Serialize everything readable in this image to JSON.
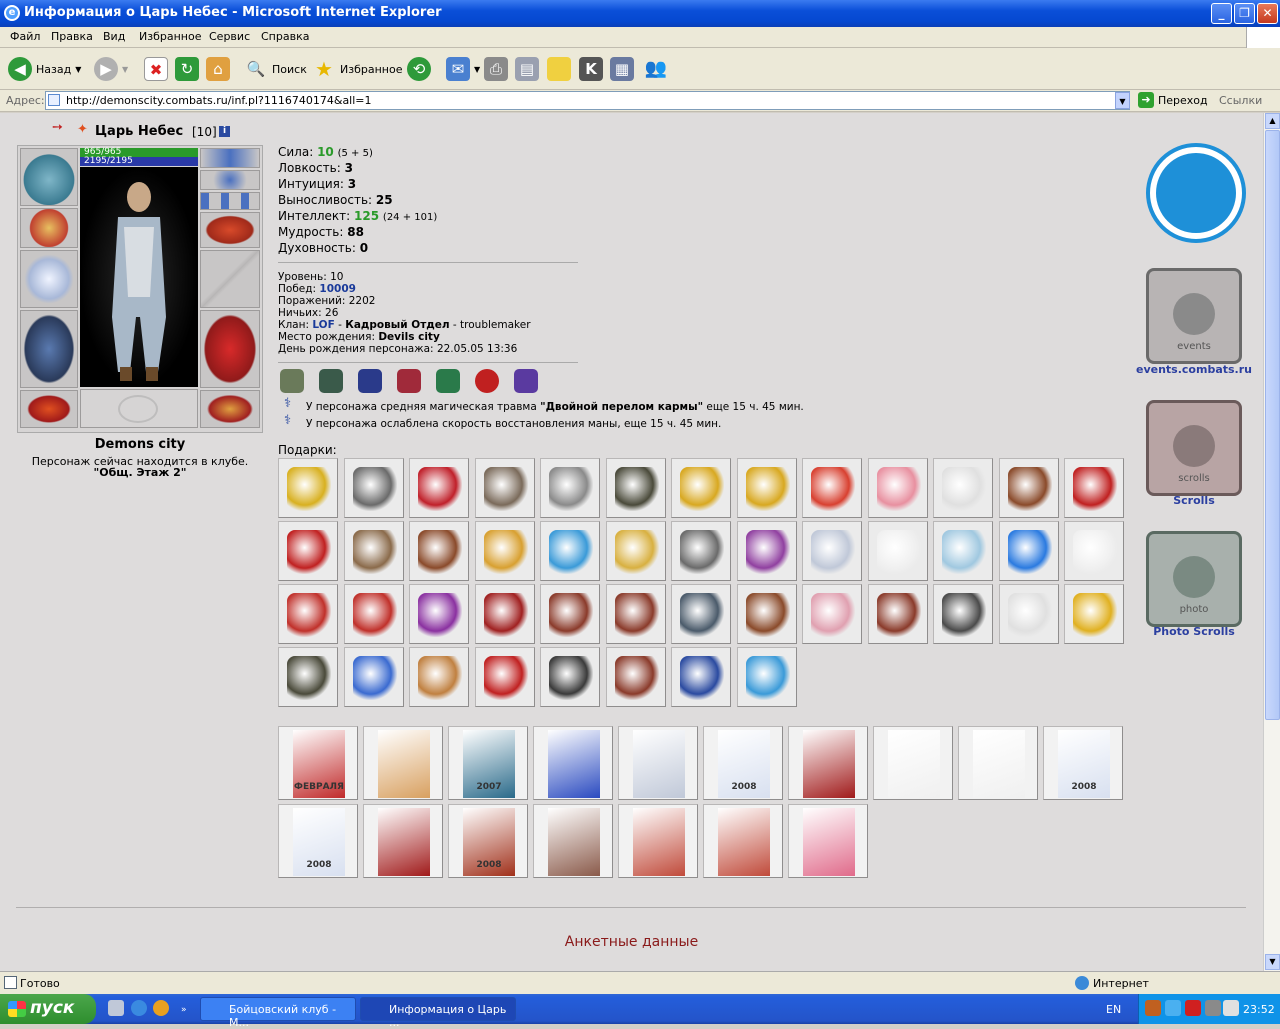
{
  "window": {
    "title": "Информация о Царь Небес - Microsoft Internet Explorer"
  },
  "menu": [
    "Файл",
    "Правка",
    "Вид",
    "Избранное",
    "Сервис",
    "Справка"
  ],
  "toolbar": {
    "back": "Назад",
    "search": "Поиск",
    "favorites": "Избранное"
  },
  "address": {
    "label": "Адрес:",
    "url": "http://demonscity.combats.ru/inf.pl?1116740174&all=1",
    "go": "Переход",
    "links": "Ссылки"
  },
  "character": {
    "name": "Царь Небес",
    "level_tag": "[10]",
    "hp": "965/965",
    "mana": "2195/2195",
    "city": "Demons city",
    "location_text": "Персонаж сейчас находится в клубе.",
    "location_room": "\"Общ. Этаж 2\""
  },
  "stats": [
    {
      "label": "Сила:",
      "value": "10",
      "extra": "(5 + 5)",
      "highlight": true
    },
    {
      "label": "Ловкость:",
      "value": "3",
      "extra": "",
      "highlight": false
    },
    {
      "label": "Интуиция:",
      "value": "3",
      "extra": "",
      "highlight": false
    },
    {
      "label": "Выносливость:",
      "value": "25",
      "extra": "",
      "highlight": false
    },
    {
      "label": "Интеллект:",
      "value": "125",
      "extra": "(24 + 101)",
      "highlight": true
    },
    {
      "label": "Мудрость:",
      "value": "88",
      "extra": "",
      "highlight": false
    },
    {
      "label": "Духовность:",
      "value": "0",
      "extra": "",
      "highlight": false
    }
  ],
  "info": {
    "level_label": "Уровень:",
    "level": "10",
    "wins_label": "Побед:",
    "wins": "10009",
    "losses_label": "Поражений:",
    "losses": "2202",
    "draws_label": "Ничьих:",
    "draws": "26",
    "clan_label": "Клан:",
    "clan": "LOF",
    "clan_sep1": " - ",
    "clan_dept": "Кадровый Отдел",
    "clan_sep2": " - troublemaker",
    "birthplace_label": "Место рождения:",
    "birthplace": "Devils city",
    "birthday_label": "День рождения персонажа:",
    "birthday": "22.05.05 13:36"
  },
  "effects": [
    {
      "pre": "У персонажа средняя магическая травма ",
      "bold": "\"Двойной перелом кармы\"",
      "post": " еще 15 ч. 45 мин."
    },
    {
      "pre": "У персонажа ослаблена скорость восстановления маны, еще 15 ч. 45 мин.",
      "bold": "",
      "post": ""
    }
  ],
  "gifts_label": "Подарки:",
  "gift_icons": [
    {
      "icon": "gold-ring-icon",
      "color": "#d8b020"
    },
    {
      "icon": "microphone-stand-icon",
      "color": "#6a6a6a"
    },
    {
      "icon": "red-skates-icon",
      "color": "#c0202a"
    },
    {
      "icon": "fishing-rod-icon",
      "color": "#7a6a5a"
    },
    {
      "icon": "keychain-icon",
      "color": "#8a8a8a"
    },
    {
      "icon": "army-hat-icon",
      "color": "#4a4a3a"
    },
    {
      "icon": "gold-bar-icon",
      "color": "#d8a820"
    },
    {
      "icon": "gold-bar-icon",
      "color": "#d8a820"
    },
    {
      "icon": "crystal-ball-icon",
      "color": "#d84030"
    },
    {
      "icon": "pig-icon",
      "color": "#e890a0"
    },
    {
      "icon": "vaseline-tube-icon",
      "color": "#e0e0e0"
    },
    {
      "icon": "wooden-mug-icon",
      "color": "#8a4a2a"
    },
    {
      "icon": "santa-icon",
      "color": "#c02020"
    },
    {
      "icon": "santa-icon",
      "color": "#c02020"
    },
    {
      "icon": "ball-icon",
      "color": "#8a6a4a"
    },
    {
      "icon": "wooden-mug-icon",
      "color": "#8a4a2a"
    },
    {
      "icon": "gold-medal-icon",
      "color": "#d8a030"
    },
    {
      "icon": "blue-bag-icon",
      "color": "#3a9ad8"
    },
    {
      "icon": "necklace-icon",
      "color": "#d8b040"
    },
    {
      "icon": "chest-icon",
      "color": "#6a6a6a"
    },
    {
      "icon": "jester-icon",
      "color": "#9040a0"
    },
    {
      "icon": "snowflake-icon",
      "color": "#c0c8d8"
    },
    {
      "icon": "snowman-icon",
      "color": "#f0f0f0"
    },
    {
      "icon": "snowflake-icon",
      "color": "#a0c8e0"
    },
    {
      "icon": "smiley-santa-icon",
      "color": "#2a7ae0"
    },
    {
      "icon": "snowman-icon",
      "color": "#f0f0f0"
    },
    {
      "icon": "chocolate-icon",
      "color": "#c0302a"
    },
    {
      "icon": "chocolate-icon",
      "color": "#c0302a"
    },
    {
      "icon": "perfume-icon",
      "color": "#8a30a0"
    },
    {
      "icon": "cloak-icon",
      "color": "#a02020"
    },
    {
      "icon": "warrior-icon",
      "color": "#8a3a2a"
    },
    {
      "icon": "warrior-icon",
      "color": "#8a3a2a"
    },
    {
      "icon": "cloak-icon",
      "color": "#4a5a6a"
    },
    {
      "icon": "reindeer-icon",
      "color": "#8a4a2a"
    },
    {
      "icon": "bull-icon",
      "color": "#e0a0b0"
    },
    {
      "icon": "warrior-icon",
      "color": "#8a3a2a"
    },
    {
      "icon": "star-award-icon",
      "color": "#4a4a4a"
    },
    {
      "icon": "hockey-mask-icon",
      "color": "#e0e0e0"
    },
    {
      "icon": "gold-five-icon",
      "color": "#e0b020"
    },
    {
      "icon": "army-hat-icon",
      "color": "#4a4a3a"
    },
    {
      "icon": "snow-maiden-icon",
      "color": "#3a6ad0"
    },
    {
      "icon": "teddy-bear-icon",
      "color": "#c08040"
    },
    {
      "icon": "santa-icon",
      "color": "#c02020"
    },
    {
      "icon": "accordion-icon",
      "color": "#3a3a3a"
    },
    {
      "icon": "warrior-icon",
      "color": "#8a3a2a"
    },
    {
      "icon": "pennant-icon",
      "color": "#2a4aa0"
    },
    {
      "icon": "blue-bag-icon",
      "color": "#3a9ad8"
    }
  ],
  "cards": [
    {
      "icon": "postcard-february-icon",
      "color": "#c02a2a",
      "text": "ФЕВРАЛЯ"
    },
    {
      "icon": "postcard-balloon-icon",
      "color": "#d8a060",
      "text": ""
    },
    {
      "icon": "postcard-tree-2007-icon",
      "color": "#2a6a8a",
      "text": "2007"
    },
    {
      "icon": "postcard-tree-icon",
      "color": "#2a4ac0",
      "text": ""
    },
    {
      "icon": "postcard-white-icon",
      "color": "#c0c8d8",
      "text": ""
    },
    {
      "icon": "postcard-2008-icon",
      "color": "#d8e0f0",
      "text": "2008"
    },
    {
      "icon": "postcard-red-icon",
      "color": "#a01a1a",
      "text": ""
    },
    {
      "icon": "postcard-balls-icon",
      "color": "#f0f0f0",
      "text": ""
    },
    {
      "icon": "postcard-balls-icon",
      "color": "#f0f0f0",
      "text": ""
    },
    {
      "icon": "postcard-2008-icon",
      "color": "#d8e0f0",
      "text": "2008"
    },
    {
      "icon": "postcard-2008-icon",
      "color": "#d8e0f0",
      "text": "2008"
    },
    {
      "icon": "postcard-red-icon",
      "color": "#a01a1a",
      "text": ""
    },
    {
      "icon": "postcard-2008-gold-icon",
      "color": "#a0301a",
      "text": "2008"
    },
    {
      "icon": "postcard-wine-icon",
      "color": "#8a5a4a",
      "text": ""
    },
    {
      "icon": "postcard-roses-icon",
      "color": "#c04a3a",
      "text": ""
    },
    {
      "icon": "postcard-roses-icon",
      "color": "#c04a3a",
      "text": ""
    },
    {
      "icon": "postcard-heart-icon",
      "color": "#e06a8a",
      "text": ""
    }
  ],
  "sidebar": {
    "events": "events.combats.ru",
    "scrolls": "Scrolls",
    "photo": "Photo Scrolls",
    "banner_events": "events",
    "banner_scrolls": "scrolls",
    "banner_photo": "photo"
  },
  "footer_title": "Анкетные данные",
  "status": {
    "text": "Готово",
    "zone": "Интернет"
  },
  "taskbar": {
    "start": "пуск",
    "task1": "Бойцовский клуб - М...",
    "task2": "Информация о Царь ...",
    "lang": "EN",
    "time": "23:52"
  }
}
